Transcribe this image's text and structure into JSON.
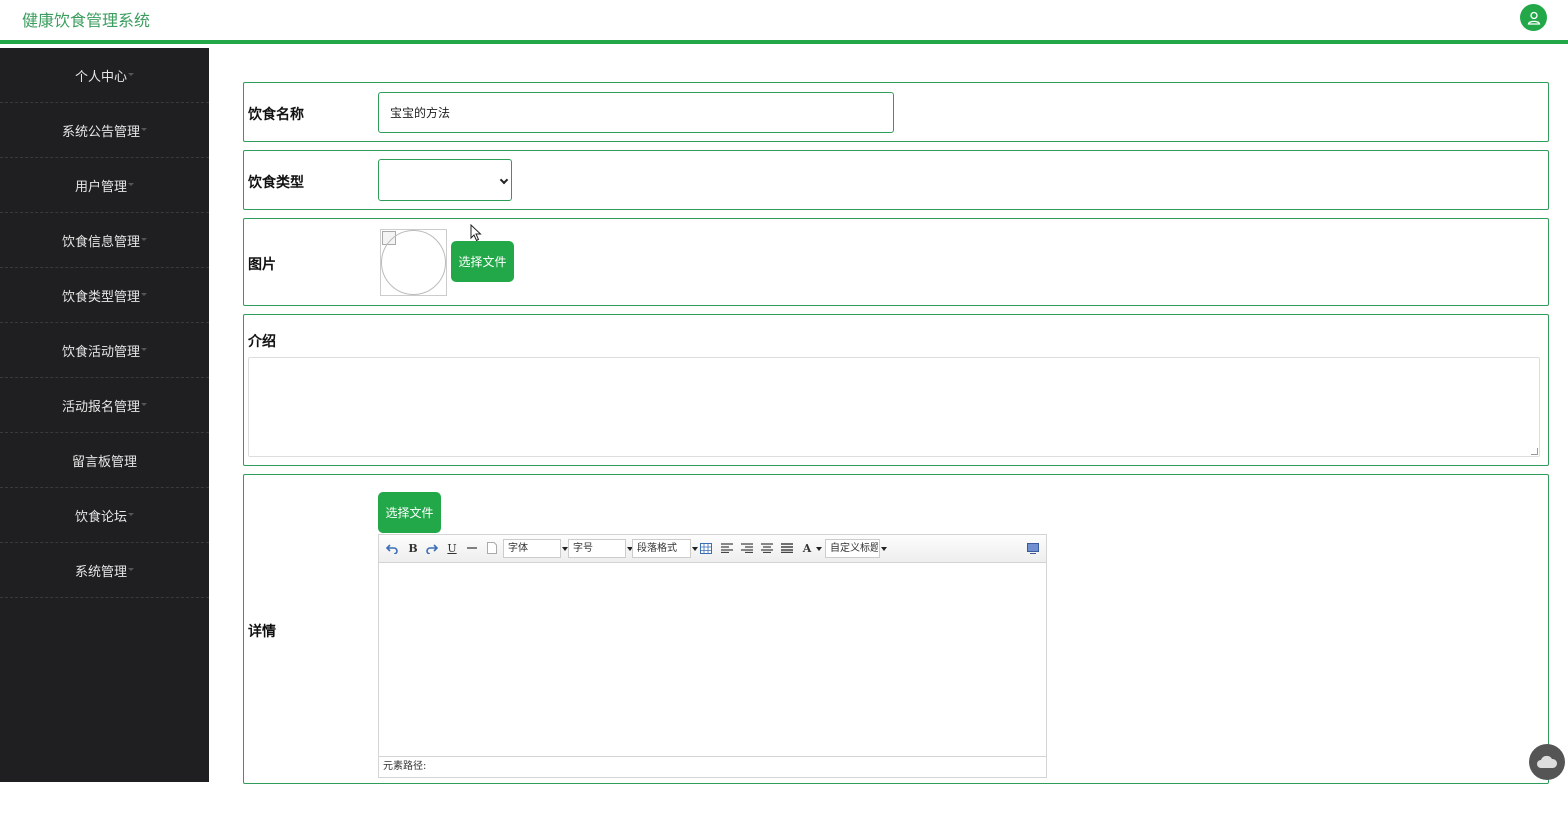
{
  "header": {
    "title": "健康饮食管理系统",
    "avatar_icon": "user-icon",
    "accent": "#22a849"
  },
  "sidebar": {
    "items": [
      {
        "label": "个人中心"
      },
      {
        "label": "系统公告管理"
      },
      {
        "label": "用户管理"
      },
      {
        "label": "饮食信息管理"
      },
      {
        "label": "饮食类型管理"
      },
      {
        "label": "饮食活动管理"
      },
      {
        "label": "活动报名管理"
      },
      {
        "label": "留言板管理"
      },
      {
        "label": "饮食论坛"
      },
      {
        "label": "系统管理"
      }
    ]
  },
  "form": {
    "name": {
      "label": "饮食名称",
      "value": "宝宝的方法"
    },
    "type": {
      "label": "饮食类型",
      "selected": ""
    },
    "image": {
      "label": "图片",
      "button": "选择文件"
    },
    "intro": {
      "label": "介绍",
      "value": ""
    },
    "detail": {
      "label": "详情",
      "button": "选择文件",
      "toolbar": {
        "font": "字体",
        "size": "字号",
        "paragraph": "段落格式",
        "custom_title": "自定义标题",
        "bold": "B",
        "underline": "U",
        "font_color": "A"
      },
      "status": "元素路径:"
    }
  }
}
